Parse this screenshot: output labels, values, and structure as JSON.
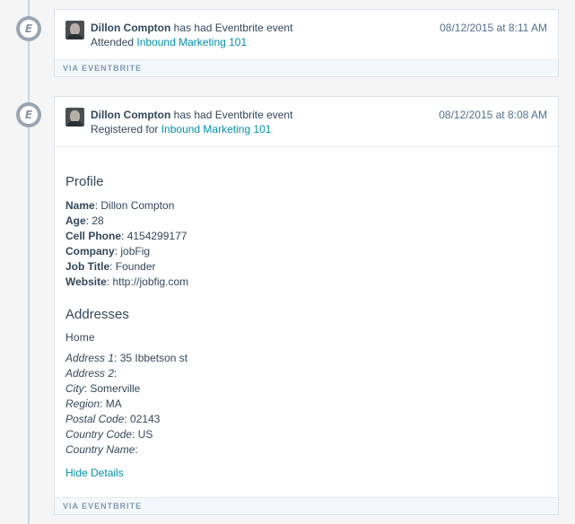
{
  "events": [
    {
      "icon": "eventbrite-icon",
      "icon_letter": "E",
      "user_name": "Dillon Compton",
      "action_text": "has had Eventbrite event",
      "detail_prefix": "Attended",
      "event_link": "Inbound Marketing 101",
      "timestamp": "08/12/2015 at 8:11 AM",
      "via": "VIA EVENTBRITE"
    },
    {
      "icon": "eventbrite-icon",
      "icon_letter": "E",
      "user_name": "Dillon Compton",
      "action_text": "has had Eventbrite event",
      "detail_prefix": "Registered for",
      "event_link": "Inbound Marketing 101",
      "timestamp": "08/12/2015 at 8:08 AM",
      "via": "VIA EVENTBRITE",
      "details": {
        "profile_heading": "Profile",
        "profile": [
          {
            "label": "Name",
            "value": "Dillon Compton"
          },
          {
            "label": "Age",
            "value": "28"
          },
          {
            "label": "Cell Phone",
            "value": "4154299177"
          },
          {
            "label": "Company",
            "value": "jobFig"
          },
          {
            "label": "Job Title",
            "value": "Founder"
          },
          {
            "label": "Website",
            "value": "http://jobfig.com"
          }
        ],
        "addresses_heading": "Addresses",
        "address_type": "Home",
        "address": [
          {
            "label": "Address 1",
            "value": "35 Ibbetson st"
          },
          {
            "label": "Address 2",
            "value": ""
          },
          {
            "label": "City",
            "value": "Somerville"
          },
          {
            "label": "Region",
            "value": "MA"
          },
          {
            "label": "Postal Code",
            "value": "02143"
          },
          {
            "label": "Country Code",
            "value": "US"
          },
          {
            "label": "Country Name",
            "value": ""
          }
        ],
        "hide_details": "Hide Details"
      }
    }
  ],
  "colors": {
    "link": "#0091ae",
    "text": "#33475b",
    "badge": "#99a5b0",
    "timeline": "#cbd6e2"
  }
}
